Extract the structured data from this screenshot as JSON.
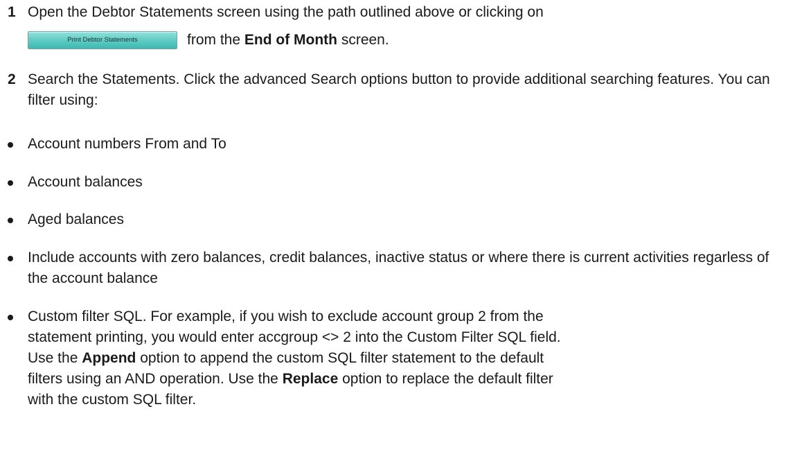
{
  "step1": {
    "number": "1",
    "text_line1": "Open the Debtor Statements screen using the path outlined above or clicking on",
    "button_label": "Print Debtor Statements",
    "text_from": "from the ",
    "text_bold": "End of Month",
    "text_after": " screen."
  },
  "step2": {
    "number": "2",
    "text": "Search the Statements. Click the advanced Search options button to provide additional searching features. You can filter using:"
  },
  "bullets": [
    {
      "text": "Account numbers From and To"
    },
    {
      "text": "Account balances"
    },
    {
      "text": "Aged balances"
    },
    {
      "text": "Include accounts with zero balances, credit balances, inactive status or where there is current activities regarless of the account balance"
    }
  ],
  "custom_bullet": {
    "line1": "Custom filter SQL. For example, if you wish to exclude account group 2 from the",
    "line2": "statement printing, you would enter accgroup <> 2 into the Custom Filter SQL field.",
    "use1": "Use the ",
    "append": "Append",
    "append_rest": " option to append the custom SQL filter statement to the default",
    "filters": "filters using an AND operation. Use the ",
    "replace": "Replace",
    "replace_rest": " option to replace the default filter",
    "last": "with the custom SQL filter."
  }
}
